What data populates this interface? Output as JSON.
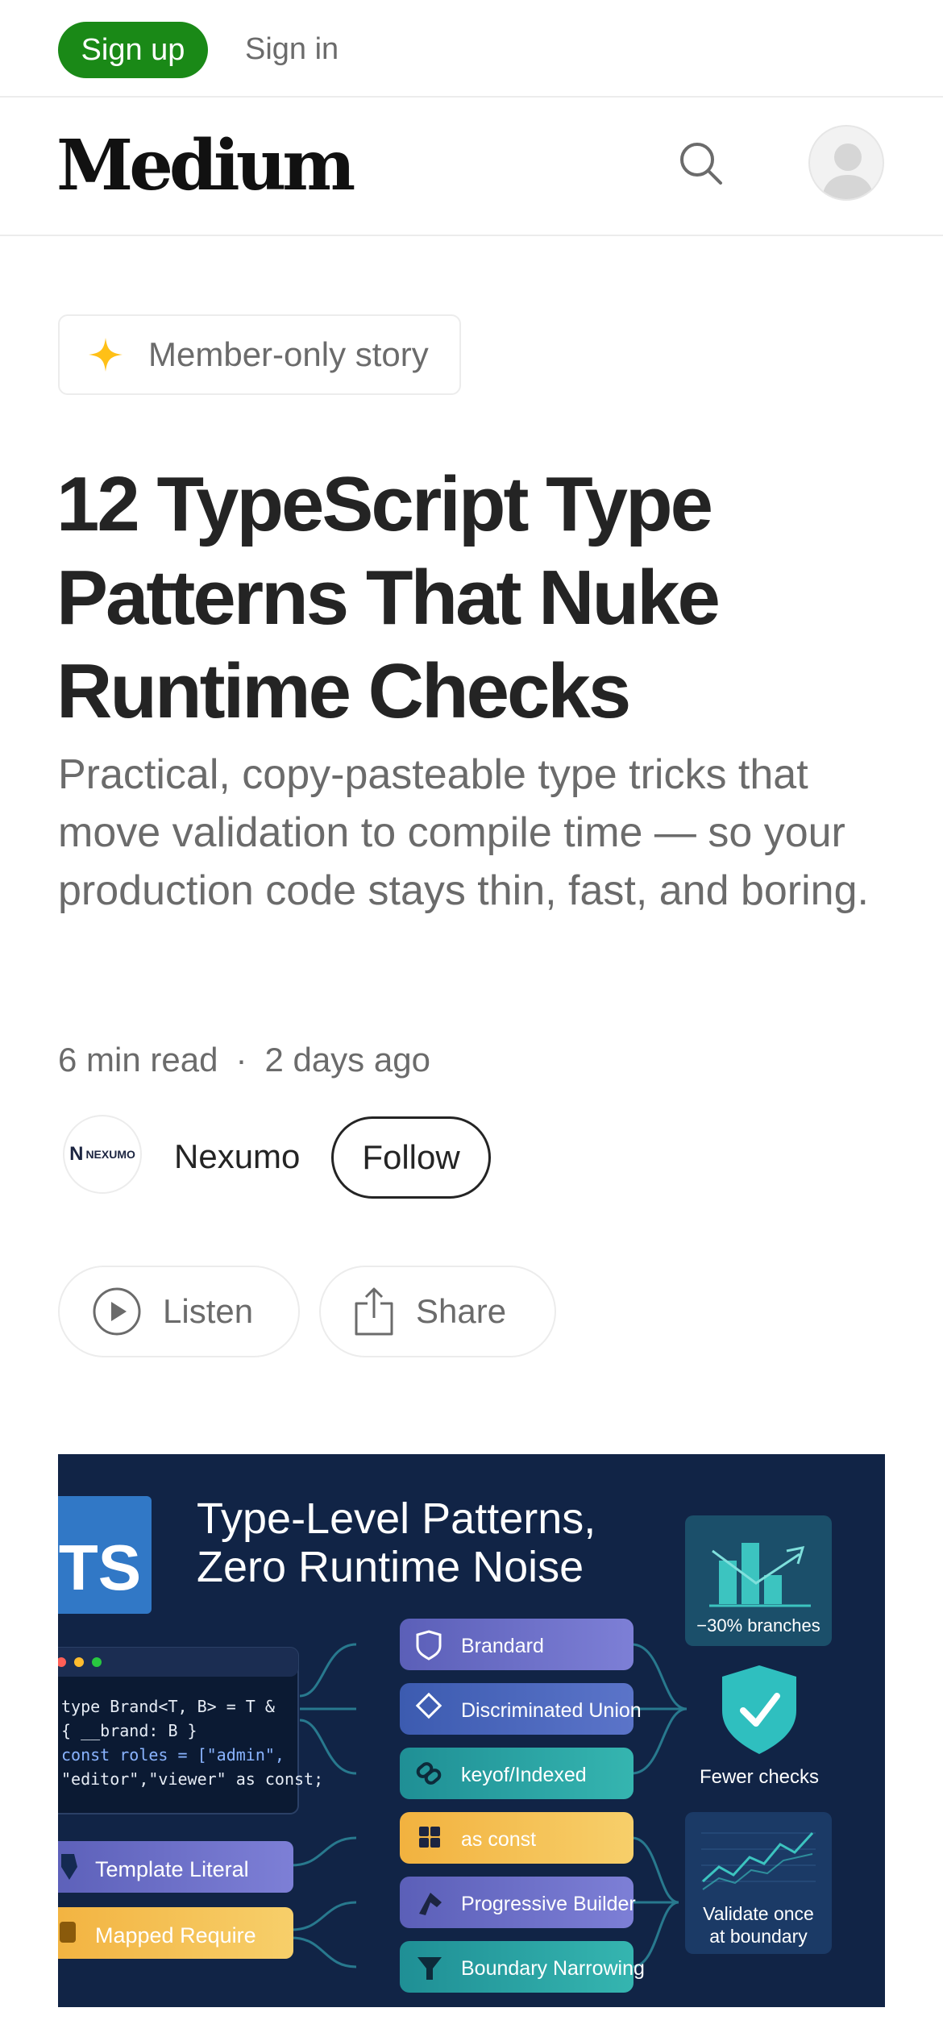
{
  "header": {
    "signup_label": "Sign up",
    "signin_label": "Sign in"
  },
  "nav": {
    "logo": "Medium",
    "icons": [
      "search-icon",
      "avatar-icon"
    ]
  },
  "article": {
    "badge": {
      "icon": "star-icon",
      "label": "Member-only story",
      "icon_color": "#ffc017"
    },
    "title": "12 TypeScript Type Patterns That Nuke Runtime Checks",
    "subtitle": "Practical, copy-pasteable type tricks that move validation to compile time — so your production code stays thin, fast, and boring.",
    "read_time": "6 min read",
    "separator": "·",
    "published": "2 days ago",
    "author": {
      "name": "Nexumo",
      "logo_text": "NEXUMO",
      "logo_letter": "N",
      "follow_label": "Follow"
    },
    "actions": {
      "listen_label": "Listen",
      "share_label": "Share"
    }
  },
  "hero_image": {
    "badge": "TS",
    "title_line1": "Type-Level Patterns,",
    "title_line2": "Zero Runtime Noise",
    "code_lines": [
      "type Brand<T, B> = T &",
      "  { __brand:  B }",
      "const roles = [\"admin\",",
      "\"editor\",\"viewer\" as const;"
    ],
    "left_pills": [
      "Template Literal",
      "Mapped Require"
    ],
    "center_pills": [
      "Brandard",
      "Discriminated Union",
      "keyof/Indexed",
      "as const",
      "Progressive Builder",
      "Boundary Narrowing"
    ],
    "stat_label": "−30% branches",
    "shield_label": "Fewer checks",
    "validate_line1": "Validate once",
    "validate_line2": "at boundary"
  },
  "colors": {
    "brand_green": "#1a8917",
    "text_primary": "#242424",
    "text_secondary": "#6b6b6b",
    "hero_bg": "#112446",
    "ts_blue": "#3178c6",
    "teal": "#2ab3b3"
  }
}
